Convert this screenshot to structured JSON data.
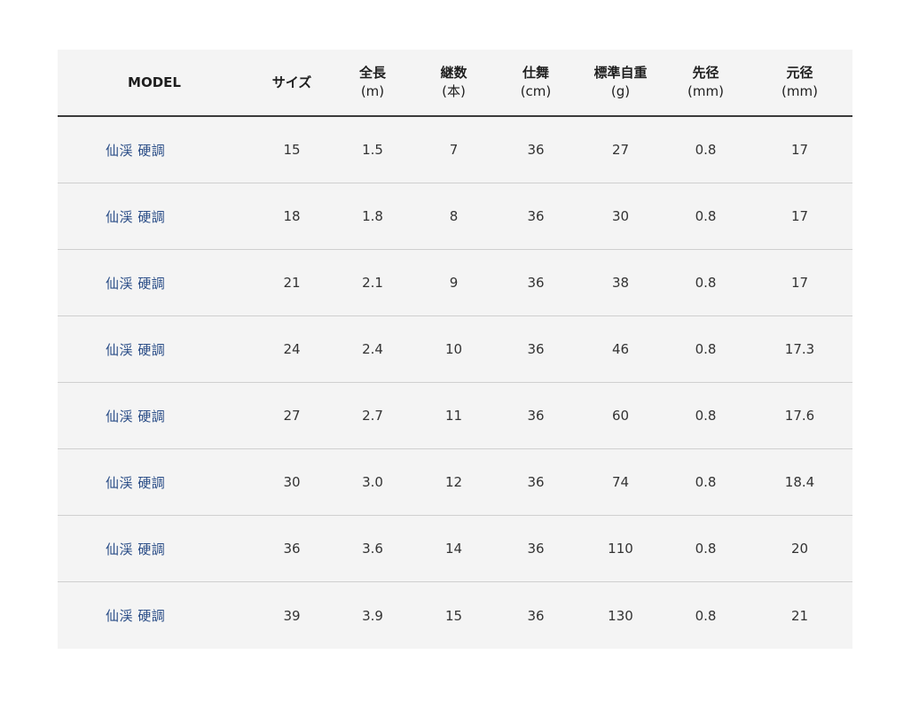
{
  "table": {
    "headers": [
      {
        "title": "MODEL",
        "unit": ""
      },
      {
        "title": "サイズ",
        "unit": ""
      },
      {
        "title": "全長",
        "unit": "(m)"
      },
      {
        "title": "継数",
        "unit": "(本)"
      },
      {
        "title": "仕舞",
        "unit": "(cm)"
      },
      {
        "title": "標準自重",
        "unit": "(g)"
      },
      {
        "title": "先径",
        "unit": "(mm)"
      },
      {
        "title": "元径",
        "unit": "(mm)"
      }
    ],
    "rows": [
      [
        "仙渓 硬調",
        "15",
        "1.5",
        "7",
        "36",
        "27",
        "0.8",
        "17"
      ],
      [
        "仙渓 硬調",
        "18",
        "1.8",
        "8",
        "36",
        "30",
        "0.8",
        "17"
      ],
      [
        "仙渓 硬調",
        "21",
        "2.1",
        "9",
        "36",
        "38",
        "0.8",
        "17"
      ],
      [
        "仙渓 硬調",
        "24",
        "2.4",
        "10",
        "36",
        "46",
        "0.8",
        "17.3"
      ],
      [
        "仙渓 硬調",
        "27",
        "2.7",
        "11",
        "36",
        "60",
        "0.8",
        "17.6"
      ],
      [
        "仙渓 硬調",
        "30",
        "3.0",
        "12",
        "36",
        "74",
        "0.8",
        "18.4"
      ],
      [
        "仙渓 硬調",
        "36",
        "3.6",
        "14",
        "36",
        "110",
        "0.8",
        "20"
      ],
      [
        "仙渓 硬調",
        "39",
        "3.9",
        "15",
        "36",
        "130",
        "0.8",
        "21"
      ]
    ]
  },
  "colors": {
    "table_background": "#f4f4f4",
    "model_link": "#2a4d87",
    "header_rule": "#3a3a3a",
    "row_divider": "#cfcfcf"
  }
}
